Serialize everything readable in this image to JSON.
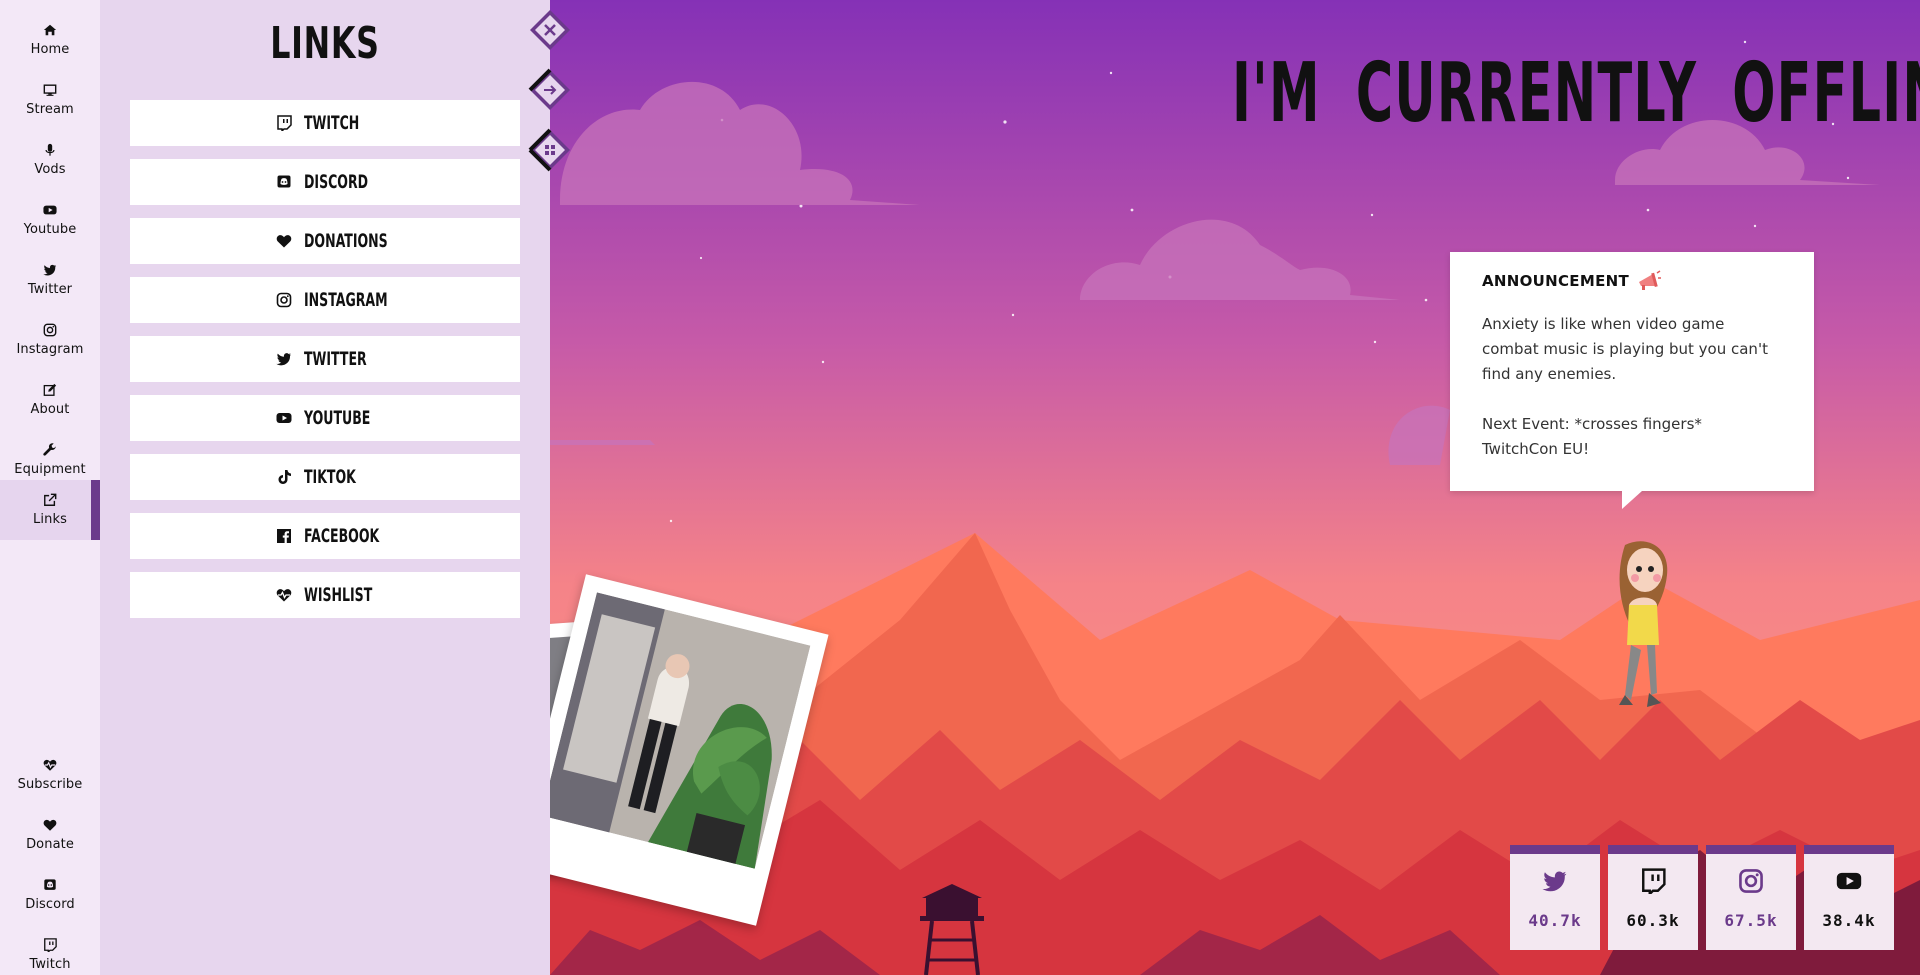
{
  "nav": {
    "items": [
      {
        "label": "Home",
        "icon": "home-icon"
      },
      {
        "label": "Stream",
        "icon": "monitor-icon"
      },
      {
        "label": "Vods",
        "icon": "microphone-icon"
      },
      {
        "label": "Youtube",
        "icon": "youtube-icon"
      },
      {
        "label": "Twitter",
        "icon": "twitter-icon"
      },
      {
        "label": "Instagram",
        "icon": "instagram-icon"
      },
      {
        "label": "About",
        "icon": "edit-icon"
      },
      {
        "label": "Equipment",
        "icon": "wrench-icon"
      },
      {
        "label": "Links",
        "icon": "external-link-icon",
        "active": true
      }
    ],
    "bottom_items": [
      {
        "label": "Subscribe",
        "icon": "heartbeat-icon"
      },
      {
        "label": "Donate",
        "icon": "heart-icon"
      },
      {
        "label": "Discord",
        "icon": "discord-icon"
      },
      {
        "label": "Twitch",
        "icon": "twitch-icon"
      }
    ]
  },
  "links_panel": {
    "title": "LINKS",
    "links": [
      {
        "label": "TWITCH",
        "icon": "twitch-icon"
      },
      {
        "label": "DISCORD",
        "icon": "discord-icon"
      },
      {
        "label": "DONATIONS",
        "icon": "heart-icon"
      },
      {
        "label": "INSTAGRAM",
        "icon": "instagram-icon"
      },
      {
        "label": "TWITTER",
        "icon": "twitter-icon"
      },
      {
        "label": "YOUTUBE",
        "icon": "youtube-icon"
      },
      {
        "label": "TIKTOK",
        "icon": "tiktok-icon"
      },
      {
        "label": "FACEBOOK",
        "icon": "facebook-icon"
      },
      {
        "label": "WISHLIST",
        "icon": "heartbeat-icon"
      }
    ],
    "controls": [
      "close-icon",
      "arrow-right-icon",
      "grid-icon"
    ]
  },
  "headline": "I'M CURRENTLY OFFLINE",
  "announcement": {
    "title": "ANNOUNCEMENT",
    "icon": "megaphone-icon",
    "body": "Anxiety is like when video game combat music is playing but you can't find any enemies.\n\nNext Event: *crosses fingers* TwitchCon EU!"
  },
  "stats": [
    {
      "icon": "twitter-icon",
      "value": "40.7k",
      "color": "#6b3a8b"
    },
    {
      "icon": "twitch-icon",
      "value": "60.3k",
      "color": "#111111"
    },
    {
      "icon": "instagram-icon",
      "value": "67.5k",
      "color": "#6b3a8b"
    },
    {
      "icon": "youtube-icon",
      "value": "38.4k",
      "color": "#111111"
    }
  ],
  "colors": {
    "accent": "#6b3a8b",
    "panel": "#e7d6ee",
    "nav": "#f3e8f7",
    "sky_top": "#8a35b8",
    "sky_bottom": "#ff8f7a"
  }
}
